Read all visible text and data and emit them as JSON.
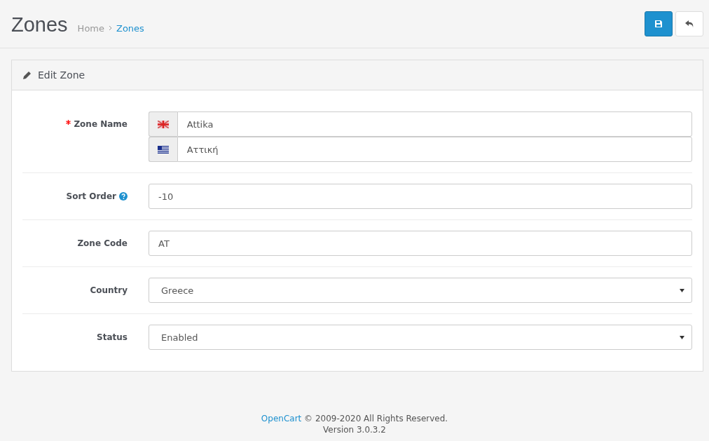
{
  "header": {
    "title": "Zones",
    "breadcrumb": [
      {
        "label": "Home",
        "selected": false
      },
      {
        "label": "Zones",
        "selected": true
      }
    ]
  },
  "panel": {
    "title": "Edit Zone"
  },
  "fields": [
    {
      "kind": "multilang",
      "label": "Zone Name",
      "required": true,
      "help": false,
      "values": [
        "Attika",
        "Αττική"
      ]
    },
    {
      "kind": "text",
      "label": "Sort Order",
      "required": false,
      "help": true,
      "value": "-10"
    },
    {
      "kind": "text",
      "label": "Zone Code",
      "required": false,
      "help": false,
      "value": "AT"
    },
    {
      "kind": "select",
      "label": "Country",
      "required": false,
      "help": false,
      "value": "Greece"
    },
    {
      "kind": "select",
      "label": "Status",
      "required": false,
      "help": false,
      "value": "Enabled"
    }
  ],
  "footer": {
    "link": "OpenCart",
    "text": "© 2009-2020 All Rights Reserved.",
    "version": "Version 3.0.3.2"
  }
}
